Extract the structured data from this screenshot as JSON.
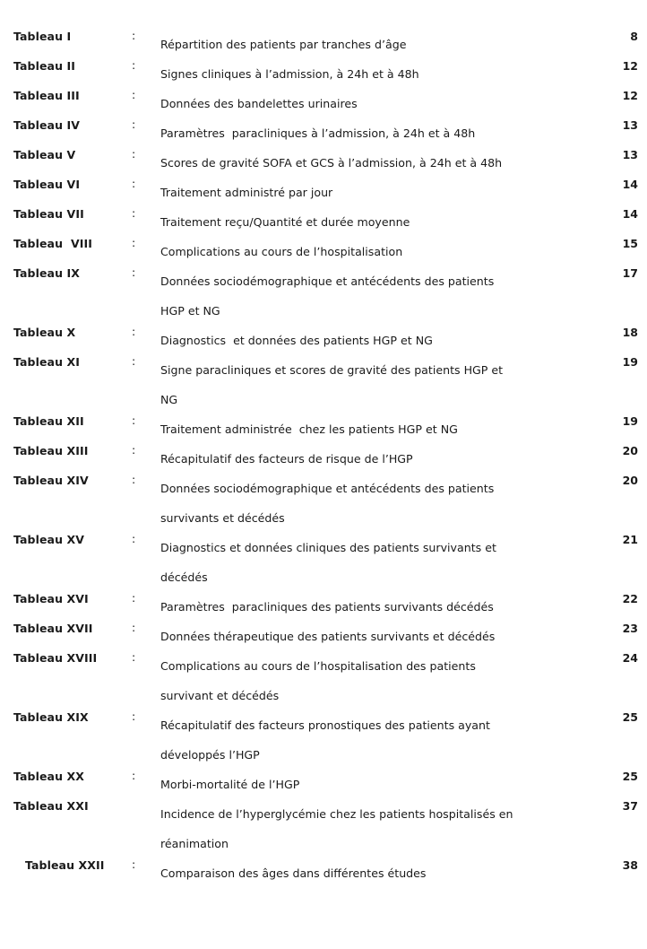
{
  "document": {
    "kind": "list-of-tables",
    "language": "fr",
    "colon_separator": ":",
    "text_color": "#1a1a1a",
    "background_color": "#ffffff"
  },
  "entries": [
    {
      "label": "Tableau I",
      "has_colon": true,
      "indented": false,
      "description": "Répartition des patients par tranches d’âge",
      "continuation": "",
      "page": "8"
    },
    {
      "label": "Tableau II",
      "has_colon": true,
      "indented": false,
      "description": "Signes cliniques à l’admission, à 24h et à 48h",
      "continuation": "",
      "page": "12"
    },
    {
      "label": "Tableau III",
      "has_colon": true,
      "indented": false,
      "description": "Données des bandelettes urinaires",
      "continuation": "",
      "page": "12"
    },
    {
      "label": "Tableau IV",
      "has_colon": true,
      "indented": false,
      "description": "Paramètres  paracliniques à l’admission, à 24h et à 48h",
      "continuation": "",
      "page": "13"
    },
    {
      "label": "Tableau V",
      "has_colon": true,
      "indented": false,
      "description": "Scores de gravité SOFA et GCS à l’admission, à 24h et à 48h",
      "continuation": "",
      "page": "13"
    },
    {
      "label": "Tableau VI",
      "has_colon": true,
      "indented": false,
      "description": "Traitement administré par jour",
      "continuation": "",
      "page": "14"
    },
    {
      "label": "Tableau VII",
      "has_colon": true,
      "indented": false,
      "description": "Traitement reçu/Quantité et durée moyenne",
      "continuation": "",
      "page": "14"
    },
    {
      "label": "Tableau  VIII",
      "has_colon": true,
      "indented": false,
      "description": "Complications au cours de l’hospitalisation",
      "continuation": "",
      "page": "15"
    },
    {
      "label": "Tableau IX",
      "has_colon": true,
      "indented": false,
      "description": "Données sociodémographique et antécédents des patients",
      "continuation": "HGP et NG",
      "page": "17"
    },
    {
      "label": "Tableau X",
      "has_colon": true,
      "indented": false,
      "description": "Diagnostics  et données des patients HGP et NG",
      "continuation": "",
      "page": "18"
    },
    {
      "label": "Tableau XI",
      "has_colon": true,
      "indented": false,
      "description": "Signe paracliniques et scores de gravité des patients HGP et",
      "continuation": "NG",
      "page": "19"
    },
    {
      "label": "Tableau XII",
      "has_colon": true,
      "indented": false,
      "description": "Traitement administrée  chez les patients HGP et NG",
      "continuation": "",
      "page": "19"
    },
    {
      "label": "Tableau XIII",
      "has_colon": true,
      "indented": false,
      "description": "Récapitulatif des facteurs de risque de l’HGP",
      "continuation": "",
      "page": "20"
    },
    {
      "label": "Tableau XIV",
      "has_colon": true,
      "indented": false,
      "description": "Données sociodémographique et antécédents des patients",
      "continuation": "survivants et décédés",
      "page": "20"
    },
    {
      "label": "Tableau XV",
      "has_colon": true,
      "indented": false,
      "description": "Diagnostics et données cliniques des patients survivants et",
      "continuation": "décédés",
      "page": "21"
    },
    {
      "label": "Tableau XVI",
      "has_colon": true,
      "indented": false,
      "description": "Paramètres  paracliniques des patients survivants décédés",
      "continuation": "",
      "page": "22"
    },
    {
      "label": "Tableau XVII",
      "has_colon": true,
      "indented": false,
      "description": "Données thérapeutique des patients survivants et décédés",
      "continuation": "",
      "page": "23"
    },
    {
      "label": "Tableau XVIII",
      "has_colon": true,
      "indented": false,
      "description": "Complications au cours de l’hospitalisation des patients",
      "continuation": "survivant et décédés",
      "page": "24"
    },
    {
      "label": "Tableau XIX",
      "has_colon": true,
      "indented": false,
      "description": "Récapitulatif des facteurs pronostiques des patients ayant",
      "continuation": "développés l’HGP",
      "page": "25"
    },
    {
      "label": "Tableau XX",
      "has_colon": true,
      "indented": false,
      "description": "Morbi-mortalité de l’HGP",
      "continuation": "",
      "page": "25"
    },
    {
      "label": "Tableau XXI",
      "has_colon": false,
      "indented": false,
      "description": "Incidence de l’hyperglycémie chez les patients hospitalisés en",
      "continuation": "réanimation",
      "page": "37"
    },
    {
      "label": "Tableau XXII",
      "has_colon": true,
      "indented": true,
      "description": "Comparaison des âges dans différentes études",
      "continuation": "",
      "page": "38"
    }
  ]
}
